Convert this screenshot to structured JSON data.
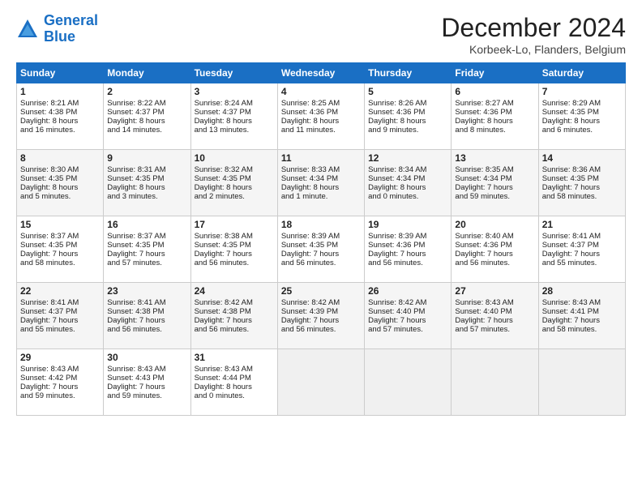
{
  "header": {
    "logo_line1": "General",
    "logo_line2": "Blue",
    "title": "December 2024",
    "location": "Korbeek-Lo, Flanders, Belgium"
  },
  "days_of_week": [
    "Sunday",
    "Monday",
    "Tuesday",
    "Wednesday",
    "Thursday",
    "Friday",
    "Saturday"
  ],
  "weeks": [
    [
      {
        "day": "1",
        "info": "Sunrise: 8:21 AM\nSunset: 4:38 PM\nDaylight: 8 hours\nand 16 minutes."
      },
      {
        "day": "2",
        "info": "Sunrise: 8:22 AM\nSunset: 4:37 PM\nDaylight: 8 hours\nand 14 minutes."
      },
      {
        "day": "3",
        "info": "Sunrise: 8:24 AM\nSunset: 4:37 PM\nDaylight: 8 hours\nand 13 minutes."
      },
      {
        "day": "4",
        "info": "Sunrise: 8:25 AM\nSunset: 4:36 PM\nDaylight: 8 hours\nand 11 minutes."
      },
      {
        "day": "5",
        "info": "Sunrise: 8:26 AM\nSunset: 4:36 PM\nDaylight: 8 hours\nand 9 minutes."
      },
      {
        "day": "6",
        "info": "Sunrise: 8:27 AM\nSunset: 4:36 PM\nDaylight: 8 hours\nand 8 minutes."
      },
      {
        "day": "7",
        "info": "Sunrise: 8:29 AM\nSunset: 4:35 PM\nDaylight: 8 hours\nand 6 minutes."
      }
    ],
    [
      {
        "day": "8",
        "info": "Sunrise: 8:30 AM\nSunset: 4:35 PM\nDaylight: 8 hours\nand 5 minutes."
      },
      {
        "day": "9",
        "info": "Sunrise: 8:31 AM\nSunset: 4:35 PM\nDaylight: 8 hours\nand 3 minutes."
      },
      {
        "day": "10",
        "info": "Sunrise: 8:32 AM\nSunset: 4:35 PM\nDaylight: 8 hours\nand 2 minutes."
      },
      {
        "day": "11",
        "info": "Sunrise: 8:33 AM\nSunset: 4:34 PM\nDaylight: 8 hours\nand 1 minute."
      },
      {
        "day": "12",
        "info": "Sunrise: 8:34 AM\nSunset: 4:34 PM\nDaylight: 8 hours\nand 0 minutes."
      },
      {
        "day": "13",
        "info": "Sunrise: 8:35 AM\nSunset: 4:34 PM\nDaylight: 7 hours\nand 59 minutes."
      },
      {
        "day": "14",
        "info": "Sunrise: 8:36 AM\nSunset: 4:35 PM\nDaylight: 7 hours\nand 58 minutes."
      }
    ],
    [
      {
        "day": "15",
        "info": "Sunrise: 8:37 AM\nSunset: 4:35 PM\nDaylight: 7 hours\nand 58 minutes."
      },
      {
        "day": "16",
        "info": "Sunrise: 8:37 AM\nSunset: 4:35 PM\nDaylight: 7 hours\nand 57 minutes."
      },
      {
        "day": "17",
        "info": "Sunrise: 8:38 AM\nSunset: 4:35 PM\nDaylight: 7 hours\nand 56 minutes."
      },
      {
        "day": "18",
        "info": "Sunrise: 8:39 AM\nSunset: 4:35 PM\nDaylight: 7 hours\nand 56 minutes."
      },
      {
        "day": "19",
        "info": "Sunrise: 8:39 AM\nSunset: 4:36 PM\nDaylight: 7 hours\nand 56 minutes."
      },
      {
        "day": "20",
        "info": "Sunrise: 8:40 AM\nSunset: 4:36 PM\nDaylight: 7 hours\nand 56 minutes."
      },
      {
        "day": "21",
        "info": "Sunrise: 8:41 AM\nSunset: 4:37 PM\nDaylight: 7 hours\nand 55 minutes."
      }
    ],
    [
      {
        "day": "22",
        "info": "Sunrise: 8:41 AM\nSunset: 4:37 PM\nDaylight: 7 hours\nand 55 minutes."
      },
      {
        "day": "23",
        "info": "Sunrise: 8:41 AM\nSunset: 4:38 PM\nDaylight: 7 hours\nand 56 minutes."
      },
      {
        "day": "24",
        "info": "Sunrise: 8:42 AM\nSunset: 4:38 PM\nDaylight: 7 hours\nand 56 minutes."
      },
      {
        "day": "25",
        "info": "Sunrise: 8:42 AM\nSunset: 4:39 PM\nDaylight: 7 hours\nand 56 minutes."
      },
      {
        "day": "26",
        "info": "Sunrise: 8:42 AM\nSunset: 4:40 PM\nDaylight: 7 hours\nand 57 minutes."
      },
      {
        "day": "27",
        "info": "Sunrise: 8:43 AM\nSunset: 4:40 PM\nDaylight: 7 hours\nand 57 minutes."
      },
      {
        "day": "28",
        "info": "Sunrise: 8:43 AM\nSunset: 4:41 PM\nDaylight: 7 hours\nand 58 minutes."
      }
    ],
    [
      {
        "day": "29",
        "info": "Sunrise: 8:43 AM\nSunset: 4:42 PM\nDaylight: 7 hours\nand 59 minutes."
      },
      {
        "day": "30",
        "info": "Sunrise: 8:43 AM\nSunset: 4:43 PM\nDaylight: 7 hours\nand 59 minutes."
      },
      {
        "day": "31",
        "info": "Sunrise: 8:43 AM\nSunset: 4:44 PM\nDaylight: 8 hours\nand 0 minutes."
      },
      {
        "day": "",
        "info": ""
      },
      {
        "day": "",
        "info": ""
      },
      {
        "day": "",
        "info": ""
      },
      {
        "day": "",
        "info": ""
      }
    ]
  ]
}
